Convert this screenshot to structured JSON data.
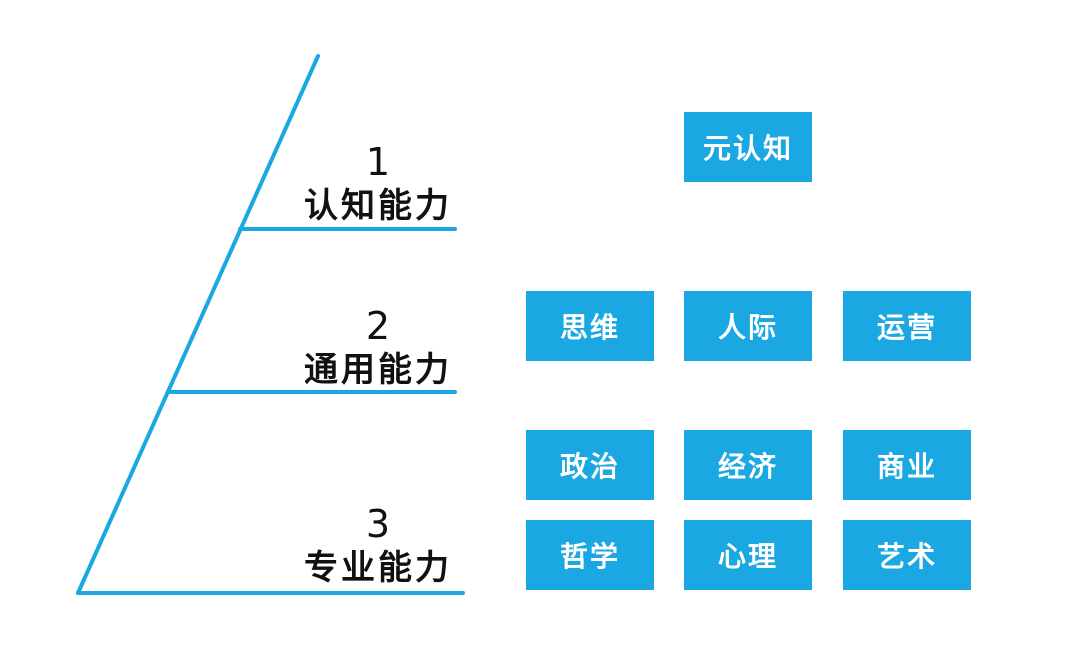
{
  "levels": [
    {
      "number": "1",
      "name": "认知能力"
    },
    {
      "number": "2",
      "name": "通用能力"
    },
    {
      "number": "3",
      "name": "专业能力"
    }
  ],
  "boxes": {
    "meta": [
      "元认知"
    ],
    "general": [
      "思维",
      "人际",
      "运营"
    ],
    "professional_row1": [
      "政治",
      "经济",
      "商业"
    ],
    "professional_row2": [
      "哲学",
      "心理",
      "艺术"
    ]
  },
  "colors": {
    "line": "#1aa7e2",
    "box": "#1aa7e2",
    "box_text": "#ffffff",
    "label_text": "#111111"
  }
}
